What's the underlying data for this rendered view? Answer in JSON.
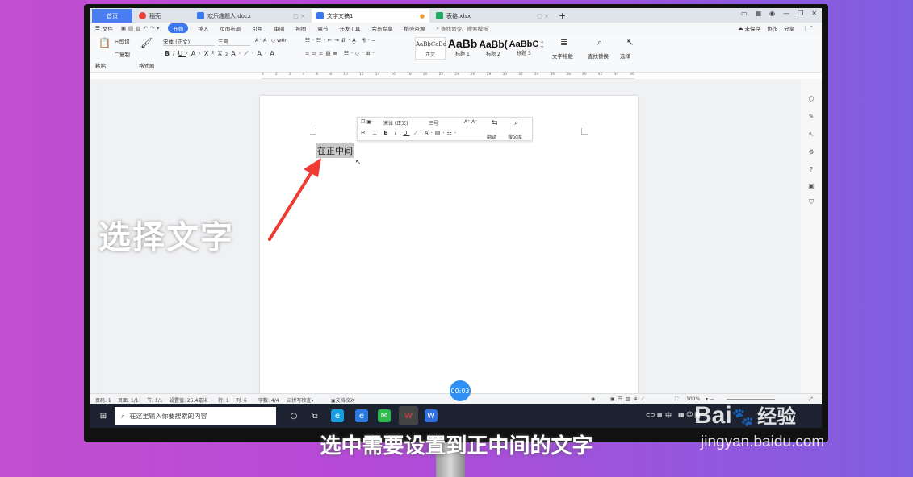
{
  "tabs": [
    {
      "label": "首页"
    },
    {
      "label": "稻壳"
    },
    {
      "label": "欢乐趣题人.docx"
    },
    {
      "label": "文字文稿1"
    },
    {
      "label": "表格.xlsx"
    }
  ],
  "menu": {
    "file": "文件",
    "items": [
      "开始",
      "插入",
      "页面布局",
      "引用",
      "审阅",
      "视图",
      "章节",
      "开发工具",
      "会员专享",
      "稻壳资源"
    ],
    "search_placeholder": "查找命令、搜索模板",
    "unsaved": "未保存",
    "collab": "协作",
    "share": "分享"
  },
  "ribbon": {
    "paste": "粘贴",
    "cut": "剪切",
    "copy": "复制",
    "format_painter": "格式刷",
    "font_name": "宋体 (正文)",
    "font_size": "三号",
    "styles": [
      {
        "preview": "AaBbCcDd",
        "label": "正文"
      },
      {
        "preview": "AaBb",
        "label": "标题 1"
      },
      {
        "preview": "AaBb(",
        "label": "标题 2"
      },
      {
        "preview": "AaBbC",
        "label": "标题 3"
      }
    ],
    "text_layout": "文字排版",
    "find_replace": "查找替换",
    "select": "选择"
  },
  "ruler_ticks": [
    "4",
    "2",
    "2",
    "4",
    "6",
    "8",
    "10",
    "12",
    "14",
    "16",
    "18",
    "20",
    "22",
    "24",
    "26",
    "28",
    "30",
    "32",
    "34",
    "36",
    "38",
    "40",
    "42",
    "44",
    "46"
  ],
  "document": {
    "selected_text": "在正中间"
  },
  "mini_toolbar": {
    "font_name": "宋体 (正文)",
    "font_size": "三号",
    "translate": "翻译",
    "search_lib": "搜文库"
  },
  "statusbar": {
    "page": "页码: 1",
    "pages": "页面: 1/1",
    "section": "节: 1/1",
    "setting": "设置值: 25.4毫米",
    "row": "行: 1",
    "col": "列: 6",
    "wordcount": "字数: 4/4",
    "spellcheck": "拼写检查",
    "proof": "文档校对",
    "zoom": "100%"
  },
  "taskbar": {
    "search_placeholder": "在这里输入你要搜索的内容",
    "ime": "中",
    "lang": "简"
  },
  "overlay": {
    "caption": "选择文字",
    "subtitle": "选中需要设置到正中间的文字",
    "timer": "00:03",
    "watermark_logo": "Bai",
    "watermark_cn": "经验",
    "watermark_url": "jingyan.baidu.com"
  }
}
